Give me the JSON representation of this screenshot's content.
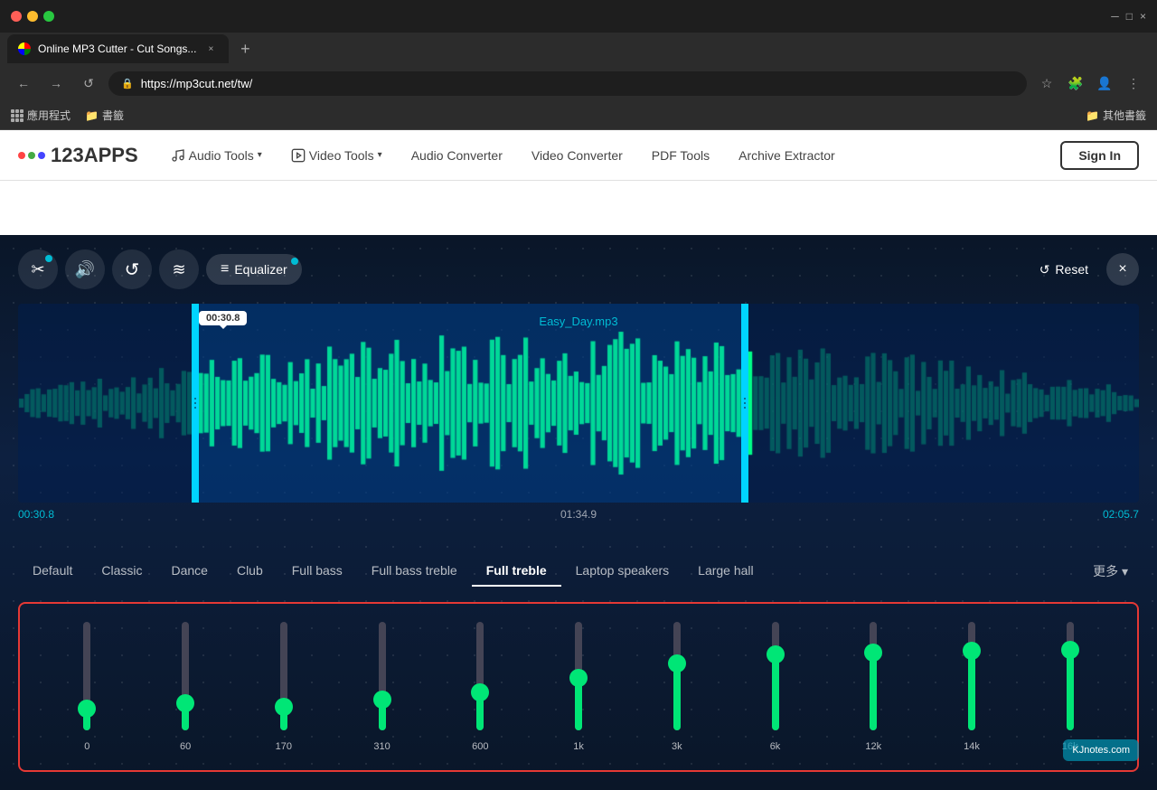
{
  "browser": {
    "title": "Online MP3 Cutter - Cut Songs...",
    "url": "https://mp3cut.net/tw/",
    "new_tab_label": "+",
    "back": "←",
    "forward": "→",
    "refresh": "↺",
    "bookmarks": [
      "應用程式",
      "書籤"
    ],
    "other_bookmarks": "其他書籤",
    "window_controls": [
      "─",
      "□",
      "×"
    ]
  },
  "navbar": {
    "logo_text": "123APPS",
    "audio_tools_label": "Audio Tools",
    "video_tools_label": "Video Tools",
    "audio_converter_label": "Audio Converter",
    "video_converter_label": "Video Converter",
    "pdf_tools_label": "PDF Tools",
    "archive_extractor_label": "Archive Extractor",
    "sign_in_label": "Sign In"
  },
  "toolbar": {
    "cut_icon": "✂",
    "volume_icon": "🔊",
    "undo_icon": "↺",
    "equalizer_icon": "≡",
    "equalizer_label": "Equalizer",
    "reset_icon": "↺",
    "reset_label": "Reset",
    "close_icon": "×"
  },
  "waveform": {
    "filename": "Easy_Day.mp3",
    "tooltip_time": "00:30.8",
    "time_left": "00:30.8",
    "time_center": "01:34.9",
    "time_right": "02:05.7"
  },
  "eq_presets": {
    "items": [
      {
        "id": "default",
        "label": "Default",
        "active": false
      },
      {
        "id": "classic",
        "label": "Classic",
        "active": false
      },
      {
        "id": "dance",
        "label": "Dance",
        "active": false
      },
      {
        "id": "club",
        "label": "Club",
        "active": false
      },
      {
        "id": "full-bass",
        "label": "Full bass",
        "active": false
      },
      {
        "id": "full-bass-treble",
        "label": "Full bass treble",
        "active": false
      },
      {
        "id": "full-treble",
        "label": "Full treble",
        "active": true
      },
      {
        "id": "laptop-speakers",
        "label": "Laptop speakers",
        "active": false
      },
      {
        "id": "large-hall",
        "label": "Large hall",
        "active": false
      }
    ],
    "more_label": "更多"
  },
  "eq_sliders": {
    "bands": [
      {
        "freq": "0",
        "value": 20,
        "fill_pct": 20,
        "thumb_pct": 20
      },
      {
        "freq": "60",
        "value": 25,
        "fill_pct": 25,
        "thumb_pct": 25
      },
      {
        "freq": "170",
        "value": 22,
        "fill_pct": 22,
        "thumb_pct": 22
      },
      {
        "freq": "310",
        "value": 28,
        "fill_pct": 28,
        "thumb_pct": 28
      },
      {
        "freq": "600",
        "value": 35,
        "fill_pct": 35,
        "thumb_pct": 35
      },
      {
        "freq": "1k",
        "value": 48,
        "fill_pct": 48,
        "thumb_pct": 48
      },
      {
        "freq": "3k",
        "value": 62,
        "fill_pct": 62,
        "thumb_pct": 62
      },
      {
        "freq": "6k",
        "value": 70,
        "fill_pct": 70,
        "thumb_pct": 70
      },
      {
        "freq": "12k",
        "value": 72,
        "fill_pct": 72,
        "thumb_pct": 72
      },
      {
        "freq": "14k",
        "value": 73,
        "fill_pct": 73,
        "thumb_pct": 73
      },
      {
        "freq": "16k",
        "value": 74,
        "fill_pct": 74,
        "thumb_pct": 74
      }
    ]
  },
  "watermark": "KJnotes.com"
}
